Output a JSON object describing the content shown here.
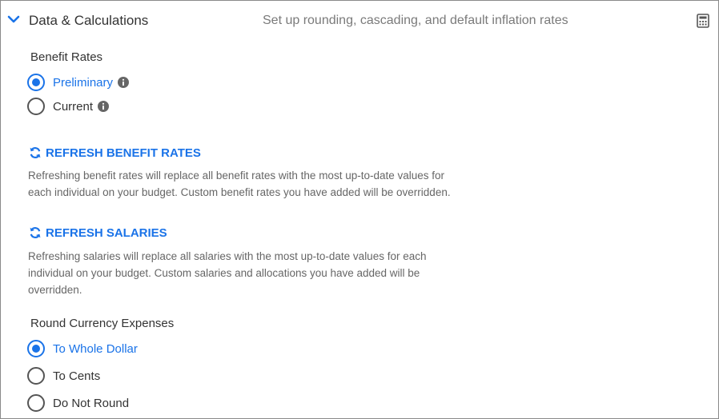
{
  "header": {
    "title": "Data & Calculations",
    "subtitle": "Set up rounding, cascading, and default inflation rates",
    "expand_icon": "chevron-down-icon",
    "action_icon": "calculator-icon"
  },
  "benefit_rates": {
    "label": "Benefit Rates",
    "options": [
      {
        "label": "Preliminary",
        "selected": true,
        "info": true
      },
      {
        "label": "Current",
        "selected": false,
        "info": true
      }
    ]
  },
  "refresh_benefit_rates": {
    "label": "REFRESH BENEFIT RATES",
    "description_line1": "Refreshing benefit rates will replace all benefit rates with the most up-to-date values for",
    "description_line2": "each individual on your budget. Custom benefit rates you have added will be overridden."
  },
  "refresh_salaries": {
    "label": "REFRESH SALARIES",
    "description_line1": "Refreshing salaries will replace all salaries with the most up-to-date values for each",
    "description_line2": "individual on your budget. Custom salaries and allocations you have added will be",
    "description_line3": "overridden."
  },
  "round_currency": {
    "label": "Round Currency Expenses",
    "options": [
      {
        "label": "To Whole Dollar",
        "selected": true
      },
      {
        "label": "To Cents",
        "selected": false
      },
      {
        "label": "Do Not Round",
        "selected": false
      }
    ]
  },
  "colors": {
    "accent": "#1a73e8",
    "text": "#333333",
    "muted": "#666666",
    "border": "#8a8a8a"
  }
}
